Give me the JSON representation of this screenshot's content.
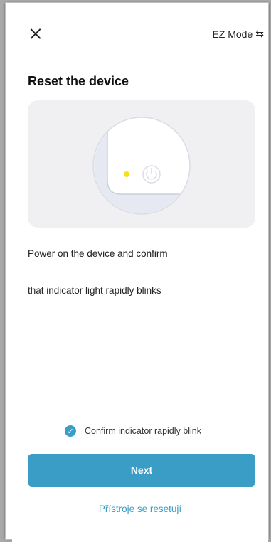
{
  "header": {
    "mode_label": "EZ Mode",
    "mode_icon": "⇆"
  },
  "page": {
    "title": "Reset the device",
    "description_line1": "Power on the device and confirm",
    "description_line2": "that indicator light rapidly blinks"
  },
  "confirm": {
    "label": "Confirm indicator rapidly blink",
    "checked": true,
    "check_glyph": "✓"
  },
  "actions": {
    "next_label": "Next",
    "link_label": "Přístroje se resetují"
  },
  "colors": {
    "accent": "#3a9dc6",
    "indicator": "#f5e11a"
  }
}
